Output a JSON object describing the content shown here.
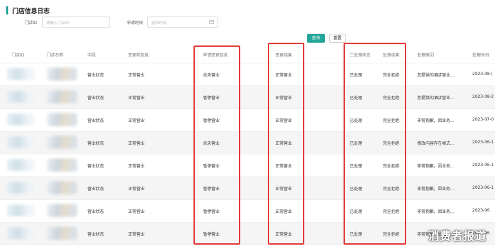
{
  "page": {
    "title": "门店信息日志"
  },
  "filters": {
    "store_id_label": "门店ID",
    "store_id_placeholder": "请输入门店ID",
    "apply_time_label": "申请时间",
    "apply_time_placeholder": "选择时间"
  },
  "actions": {
    "query_label": "查询",
    "reset_label": "重置"
  },
  "table": {
    "headers": [
      "门店ID",
      "门店名称",
      "字段",
      "变更前信息",
      "申请变更信息",
      "变更结果",
      "二处理状态",
      "处理结果",
      "处理原因",
      "处理时间"
    ],
    "rows": [
      {
        "field": "营业状态",
        "before": "正常营业",
        "requested": "尚未营业",
        "result": "正常营业",
        "status": "已处理",
        "outcome": "完全拒绝",
        "reason": "您提供的酒店营业...",
        "time": "2023-08-("
      },
      {
        "field": "营业状态",
        "before": "正常营业",
        "requested": "暂停营业",
        "result": "正常营业",
        "status": "已处理",
        "outcome": "完全拒绝",
        "reason": "您提供的酒店营业...",
        "time": "2023-08-2"
      },
      {
        "field": "营业状态",
        "before": "正常营业",
        "requested": "暂停营业",
        "result": "正常营业",
        "status": "已处理",
        "outcome": "完全拒绝",
        "reason": "非常抱歉，因业务...",
        "time": "2023-07-0"
      },
      {
        "field": "营业状态",
        "before": "正常营业",
        "requested": "尚未营业",
        "result": "正常营业",
        "status": "已处理",
        "outcome": "完全拒绝",
        "reason": "修改内容存在格式...",
        "time": "2023-06-1"
      },
      {
        "field": "营业状态",
        "before": "正常营业",
        "requested": "暂停营业",
        "result": "正常营业",
        "status": "已处理",
        "outcome": "完全拒绝",
        "reason": "非常抱歉，因业务...",
        "time": "2023-06-1"
      },
      {
        "field": "营业状态",
        "before": "正常营业",
        "requested": "暂停营业",
        "result": "正常营业",
        "status": "已处理",
        "outcome": "完全拒绝",
        "reason": "非常抱歉，因业务...",
        "time": "2023-06-1"
      },
      {
        "field": "营业状态",
        "before": "正常营业",
        "requested": "暂停营业",
        "result": "正常营业",
        "status": "已处理",
        "outcome": "完全拒绝",
        "reason": "非常抱歉，因业务...",
        "time": "2023-06"
      },
      {
        "field": "营业状态",
        "before": "正常营业",
        "requested": "暂停营业",
        "result": "正常营业",
        "status": "已处理",
        "outcome": "完全拒绝",
        "reason": "非常抱歉，因业务...",
        "time": "2023-06"
      }
    ]
  },
  "watermark": "消费者报道",
  "colors": {
    "accent": "#26a69a",
    "highlight": "#e53935"
  }
}
